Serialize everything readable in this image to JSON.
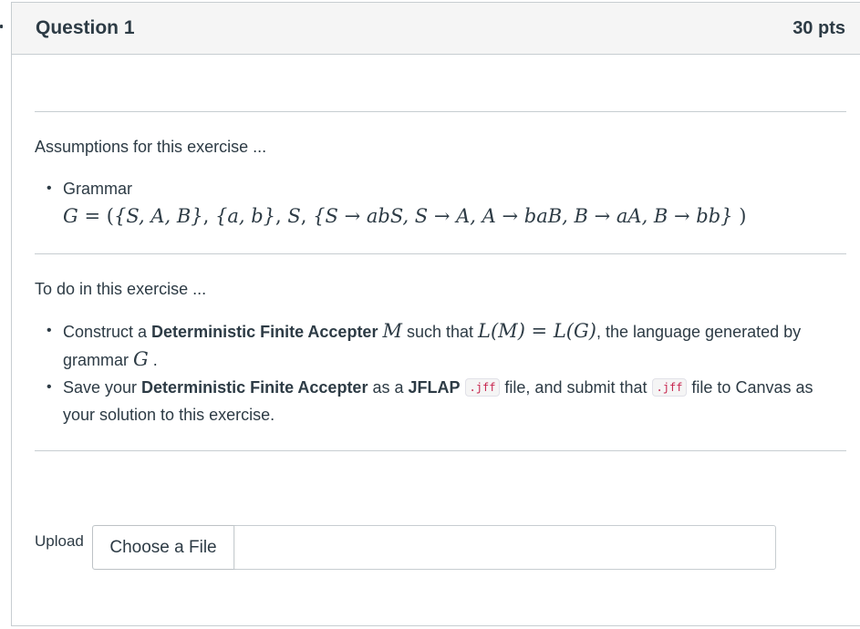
{
  "question": {
    "title": "Question 1",
    "points": "30 pts"
  },
  "assumptions": {
    "heading": "Assumptions for this exercise ...",
    "bullets": {
      "grammar_label": "Grammar",
      "grammar_math": {
        "lhs": "G",
        "eq": "=",
        "open": "(",
        "nonterminals": "{S, A, B}",
        "terminals": "{a, b}",
        "start": "S",
        "productions": "{S → abS, S → A, A → baB, B → aA, B → bb}",
        "close": ")"
      }
    }
  },
  "todo": {
    "heading": "To do in this exercise ...",
    "bullet1": {
      "t1": "Construct a ",
      "b1": "Deterministic Finite Accepter",
      "m1": "M",
      "t2": " such that ",
      "m2": "L(M) = L(G)",
      "t3": ", the language generated by grammar ",
      "m3": "G",
      "t4": " ."
    },
    "bullet2": {
      "t1": "Save your ",
      "b1": "Deterministic Finite Accepter",
      "t2": " as a ",
      "b2": "JFLAP",
      "code1": ".jff",
      "t3": " file, and submit that ",
      "code2": ".jff",
      "t4": " file to Canvas as your solution to this exercise."
    }
  },
  "upload": {
    "label": "Upload",
    "button": "Choose a File",
    "file_name": ""
  }
}
